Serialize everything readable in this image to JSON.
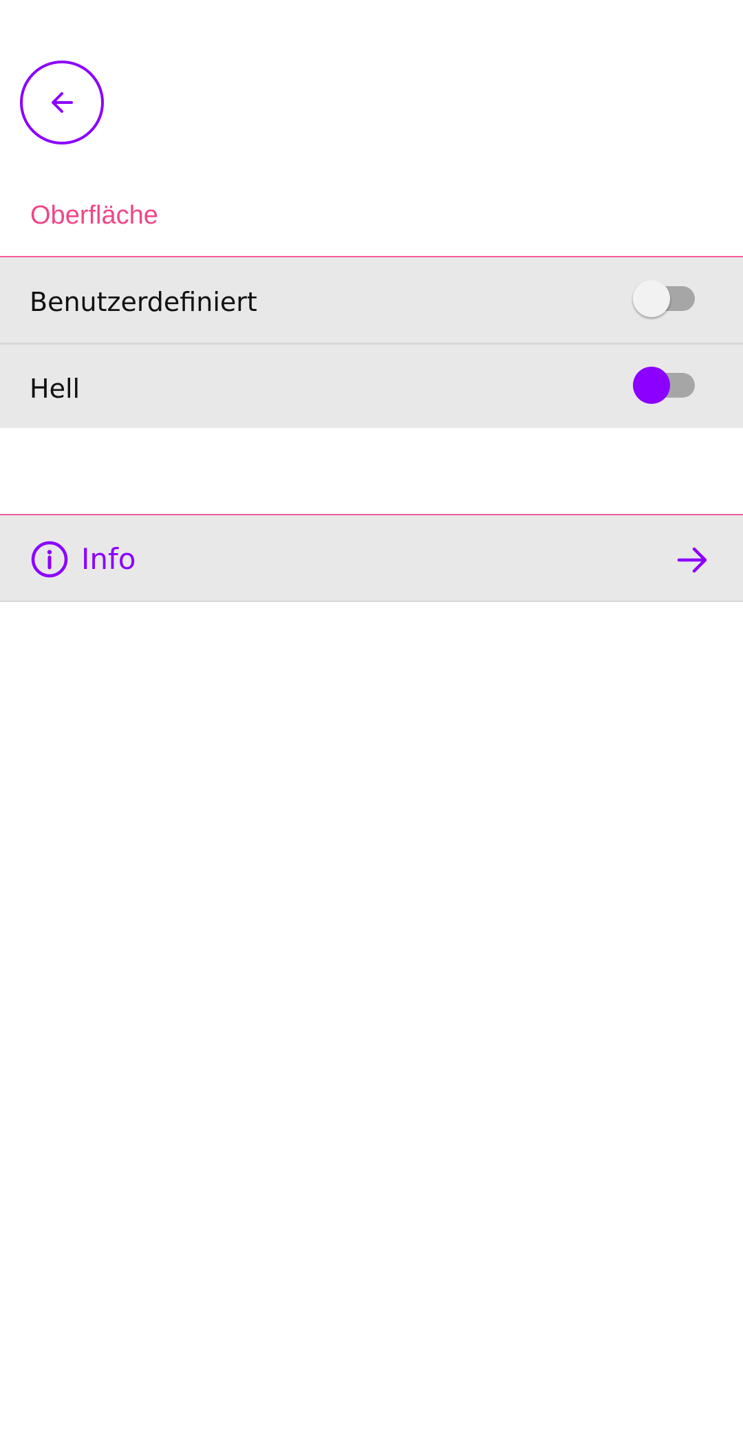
{
  "header": {
    "back_icon": "arrow-left-icon"
  },
  "section": {
    "title": "Oberfläche"
  },
  "settings": [
    {
      "label": "Benutzerdefiniert",
      "enabled": false
    },
    {
      "label": "Hell",
      "enabled": true
    }
  ],
  "info": {
    "label": "Info",
    "leading_icon": "info-circle-icon",
    "trailing_icon": "arrow-right-icon"
  },
  "colors": {
    "accent": "#8b00ff",
    "section_title": "#f0468a",
    "divider": "#f25a9c",
    "row_background": "#e8e8e8",
    "switch_track": "#a6a6a6",
    "switch_thumb_off": "#f2f2f2"
  }
}
